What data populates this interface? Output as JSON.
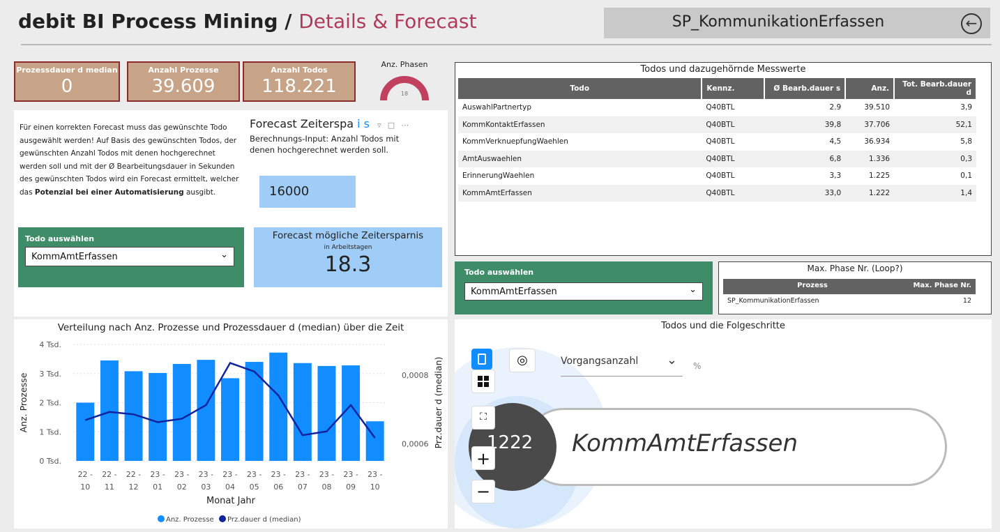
{
  "header": {
    "title_main": "debit BI Process Mining /",
    "title_sub": "Details & Forecast",
    "process_name": "SP_KommunikationErfassen",
    "back_icon": "back-arrow-icon"
  },
  "kpis": [
    {
      "label": "Prozessdauer d median",
      "value": "0"
    },
    {
      "label": "Anzahl Prozesse",
      "value": "39.609"
    },
    {
      "label": "Anzahl Todos",
      "value": "118.221"
    }
  ],
  "phases_gauge": {
    "label": "Anz. Phasen",
    "value": "18"
  },
  "forecast_intro": {
    "line1": "Für einen korrekten Forecast muss das gewünschte Todo",
    "line2": "ausgewählt werden! Auf Basis des gewünschten Todos, der",
    "line3": "gewünschten Anzahl Todos mit denen hochgerechnet",
    "line4": "werden soll und mit der Ø Bearbeitungsdauer in Sekunden",
    "line5": "des gewünschten Todos wird ein Forecast ermittelt, welcher",
    "line6_pre": "das ",
    "line6_bold": "Potenzial bei einer Automatisierung",
    "line6_post": " ausgibt."
  },
  "forecast_input": {
    "title": "Forecast Zeiterspa",
    "title_tail": "i  s",
    "desc_line1": "Berechnungs-Input: Anzahl Todos mit",
    "desc_line2": "denen hochgerechnet werden soll.",
    "value": "16000"
  },
  "todo_select_left": {
    "label": "Todo auswählen",
    "value": "KommAmtErfassen"
  },
  "forecast_result": {
    "title": "Forecast mögliche Zeitersparnis",
    "subtitle": "in Arbeitstagen",
    "value": "18.3"
  },
  "todos_table": {
    "title": "Todos und dazugehörnde Messwerte",
    "columns": [
      "Todo",
      "Kennz.",
      "Ø Bearb.dauer s",
      "Anz.",
      "Tot. Bearb.dauer d"
    ],
    "rows": [
      [
        "AuswahlPartnertyp",
        "Q40BTL",
        "2.9",
        "39.510",
        "3,9"
      ],
      [
        "KommKontaktErfassen",
        "Q40BTL",
        "39,8",
        "37.706",
        "52,1"
      ],
      [
        "KommVerknuepfungWaehlen",
        "Q40BTL",
        "4,5",
        "36.934",
        "5,8"
      ],
      [
        "AmtAuswaehlen",
        "Q40BTL",
        "6,8",
        "1.336",
        "0,3"
      ],
      [
        "ErinnerungWaehlen",
        "Q40BTL",
        "3,3",
        "1.225",
        "0,1"
      ],
      [
        "KommAmtErfassen",
        "Q40BTL",
        "33,0",
        "1.222",
        "1,4"
      ]
    ]
  },
  "todo_select_right": {
    "label": "Todo auswählen",
    "value": "KommAmtErfassen"
  },
  "max_phase": {
    "title": "Max. Phase Nr. (Loop?)",
    "columns": [
      "Prozess",
      "Max. Phase Nr."
    ],
    "row": [
      "SP_KommunikationErfassen",
      "12"
    ]
  },
  "followup": {
    "title": "Todos und die Folgeschritte",
    "dropdown": "Vorgangsanzahl",
    "percent": "%",
    "node_count": "1222",
    "node_label": "KommAmtErfassen",
    "zoom_in": "+",
    "zoom_out": "−"
  },
  "chart_data": {
    "type": "bar+line",
    "title": "Verteilung nach Anz. Prozesse und Prozessdauer d (median) über die Zeit",
    "xlabel": "Monat Jahr",
    "ylabel_left": "Anz. Prozesse",
    "ylabel_right": "Prz.dauer d (median)",
    "categories": [
      [
        "22 -",
        "10"
      ],
      [
        "22 -",
        "11"
      ],
      [
        "22 -",
        "12"
      ],
      [
        "23 -",
        "01"
      ],
      [
        "23 -",
        "02"
      ],
      [
        "23 -",
        "03"
      ],
      [
        "23 -",
        "04"
      ],
      [
        "23 -",
        "05"
      ],
      [
        "23 -",
        "06"
      ],
      [
        "23 -",
        "07"
      ],
      [
        "23 -",
        "08"
      ],
      [
        "23 -",
        "09"
      ],
      [
        "23 -",
        "10"
      ]
    ],
    "left_ticks": [
      "0 Tsd.",
      "1 Tsd.",
      "2 Tsd.",
      "3 Tsd.",
      "4 Tsd."
    ],
    "right_ticks": [
      "0,0006",
      "0,0008"
    ],
    "ylim_left": [
      0,
      4000
    ],
    "ylim_right": [
      0.00055,
      0.00089
    ],
    "series": [
      {
        "name": "Anz. Prozesse",
        "type": "bar",
        "color": "#118dff",
        "values": [
          2000,
          3450,
          3080,
          3020,
          3330,
          3470,
          2840,
          3400,
          3720,
          3360,
          3260,
          3280,
          1360
        ]
      },
      {
        "name": "Prz.dauer d (median)",
        "type": "line",
        "color": "#12239e",
        "values": [
          0.000669,
          0.000693,
          0.000686,
          0.000663,
          0.000673,
          0.000713,
          0.000836,
          0.000811,
          0.000741,
          0.000625,
          0.000636,
          0.000713,
          0.000617
        ]
      }
    ],
    "legend_position": "bottom"
  }
}
